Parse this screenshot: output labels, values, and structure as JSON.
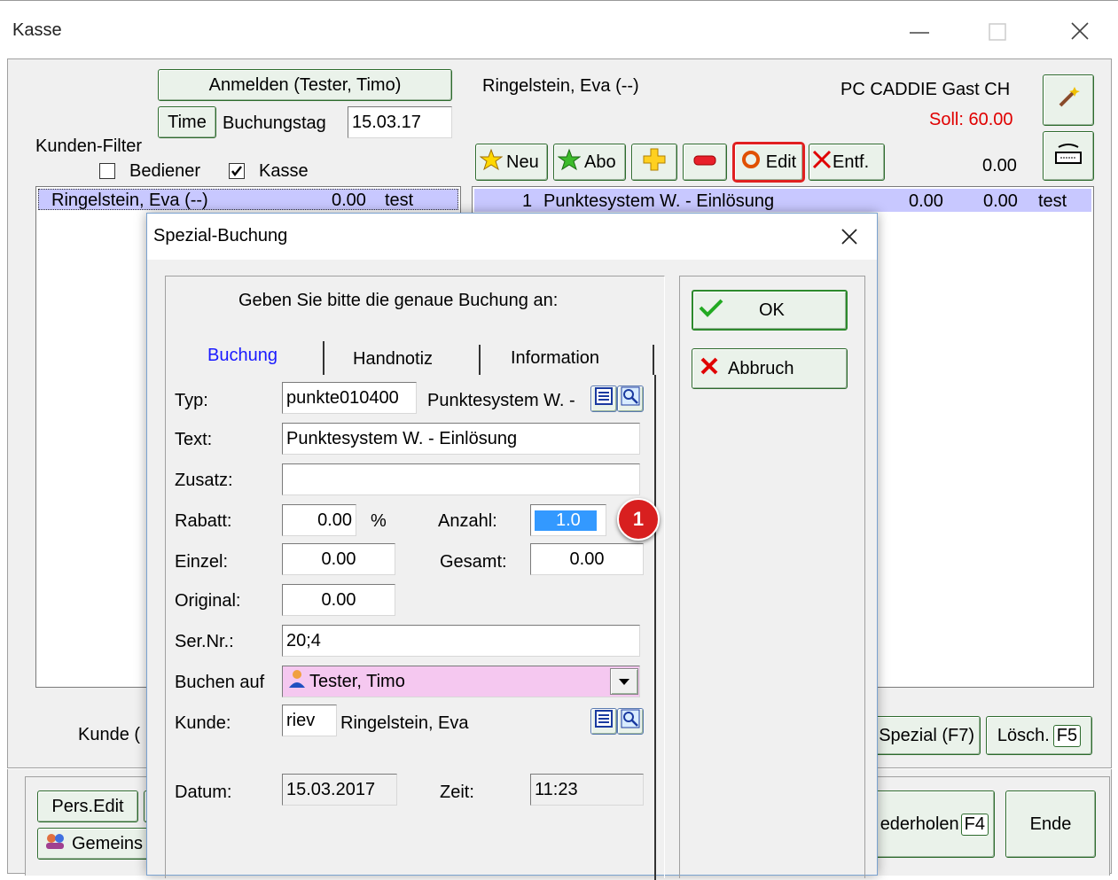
{
  "window": {
    "title": "Kasse"
  },
  "header": {
    "login_button": "Anmelden (Tester, Timo)",
    "time_button": "Time",
    "booking_day_label": "Buchungstag",
    "booking_day_value": "15.03.17",
    "customer_name": "Ringelstein, Eva (--)",
    "company": "PC CADDIE Gast CH",
    "soll": "Soll: 60.00",
    "total": "0.00"
  },
  "filter": {
    "label": "Kunden-Filter",
    "bediener_label": "Bediener",
    "bediener_checked": false,
    "kasse_label": "Kasse",
    "kasse_checked": true
  },
  "customer_list": [
    {
      "name": "Ringelstein, Eva (--)",
      "amount": "0.00",
      "note": "test"
    }
  ],
  "toolbar": {
    "neu": "Neu",
    "abo": "Abo",
    "edit": "Edit",
    "entf": "Entf."
  },
  "booking_list": [
    {
      "index": "1",
      "text": "Punktesystem W. - Einlösung",
      "v1": "0.00",
      "v2": "0.00",
      "note": "test"
    }
  ],
  "bottom": {
    "kunde_label": "Kunde (",
    "spezial_button": "Spezial (F7)",
    "loesch_button": "Lösch.",
    "loesch_key": "F5",
    "pers_edit_button": "Pers.Edit",
    "gemeins_button": "Gemeins",
    "wiederholen_button": "ederholen",
    "wiederholen_key": "F4",
    "ende_button": "Ende"
  },
  "dialog": {
    "title": "Spezial-Buchung",
    "prompt": "Geben Sie bitte die genaue Buchung an:",
    "tabs": [
      "Buchung",
      "Handnotiz",
      "Information"
    ],
    "active_tab": "Buchung",
    "ok_button": "OK",
    "cancel_button": "Abbruch",
    "fields": {
      "typ_label": "Typ:",
      "typ_code": "punkte010400",
      "typ_name": "Punktesystem W. -",
      "text_label": "Text:",
      "text_value": "Punktesystem W. - Einlösung",
      "zusatz_label": "Zusatz:",
      "zusatz_value": "",
      "rabatt_label": "Rabatt:",
      "rabatt_value": "0.00",
      "percent": "%",
      "anzahl_label": "Anzahl:",
      "anzahl_value": "1.0",
      "einzel_label": "Einzel:",
      "einzel_value": "0.00",
      "gesamt_label": "Gesamt:",
      "gesamt_value": "0.00",
      "original_label": "Original:",
      "original_value": "0.00",
      "sernr_label": "Ser.Nr.:",
      "sernr_value": "20;4",
      "buchen_label": "Buchen auf",
      "buchen_value": "Tester, Timo",
      "kunde_label": "Kunde:",
      "kunde_code": "riev",
      "kunde_name": "Ringelstein, Eva",
      "datum_label": "Datum:",
      "datum_value": "15.03.2017",
      "zeit_label": "Zeit:",
      "zeit_value": "11:23"
    },
    "callout": "1"
  },
  "colors": {
    "selection": "#c8c8ff",
    "soll": "#e00000",
    "callout": "#d81f1f",
    "dropdown": "#f5c8f0",
    "tab_active": "#1a1aff"
  }
}
